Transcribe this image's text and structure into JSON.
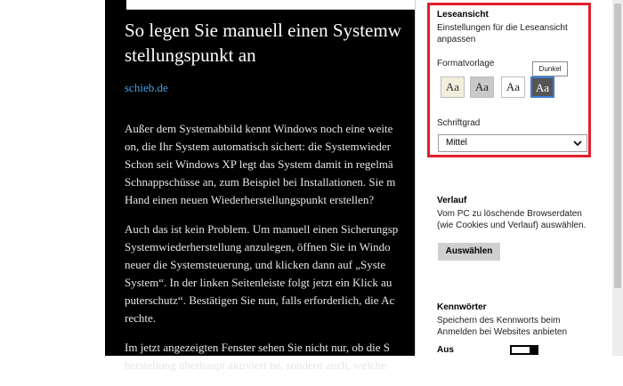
{
  "article": {
    "title_line1": "So legen Sie manuell einen Systemw",
    "title_line2": "stellungspunkt an",
    "source": "schieb.de",
    "paragraphs": [
      [
        "Außer dem Systemabbild kennt Windows noch eine weite",
        "on, die Ihr System automatisch sichert: die Systemwieder",
        "Schon seit Windows XP legt das System damit in regelmä",
        "Schnappschüsse an, zum Beispiel bei Installationen. Sie m",
        "Hand einen neuen Wiederherstellungspunkt erstellen?"
      ],
      [
        "Auch das ist kein Problem. Um manuell einen Sicherungsp",
        "Systemwiederherstellung anzulegen, öffnen Sie in Windo",
        "neuer die Systemsteuerung, und klicken dann auf „Syste",
        "System“. In der linken Seitenleiste folgt jetzt ein Klick au",
        "puterschutz“. Bestätigen Sie nun, falls erforderlich, die Ac",
        "rechte."
      ],
      [
        "Im jetzt angezeigten Fenster sehen Sie nicht nur, ob die S",
        "herstellung überhaupt aktiviert ist, sondern auch, welche"
      ]
    ]
  },
  "settings": {
    "reading_view": {
      "title": "Leseansicht",
      "description_line1": "Einstellungen für die Leseansicht",
      "description_line2": "anpassen",
      "style_label": "Formatvorlage",
      "swatches": [
        {
          "label": "Aa",
          "bg": "#f4eedc",
          "fg": "#333333"
        },
        {
          "label": "Aa",
          "bg": "#c9c9c9",
          "fg": "#222222"
        },
        {
          "label": "Aa",
          "bg": "#ffffff",
          "fg": "#222222"
        },
        {
          "label": "Aa",
          "bg": "#555555",
          "fg": "#ffffff"
        }
      ],
      "tooltip": "Dunkel",
      "font_size_label": "Schriftgrad",
      "font_size_value": "Mittel"
    },
    "history": {
      "title": "Verlauf",
      "description_line1": "Vom PC zu löschende Browserdaten",
      "description_line2": "(wie Cookies und Verlauf) auswählen.",
      "button": "Auswählen"
    },
    "passwords": {
      "title": "Kennwörter",
      "description_line1": "Speichern des Kennworts beim",
      "description_line2": "Anmelden bei Websites anbieten",
      "toggle_state": "Aus"
    }
  },
  "colors": {
    "highlight": "#e0202a",
    "link": "#4aa3e6",
    "selected_border": "#3a7bd5"
  }
}
